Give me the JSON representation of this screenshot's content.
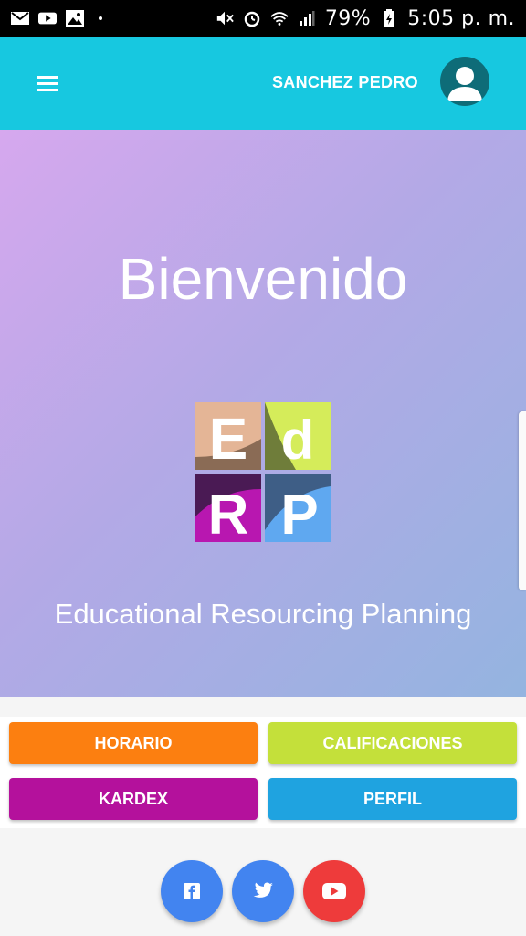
{
  "status_bar": {
    "battery": "79%",
    "time": "5:05 p. m.",
    "icons": [
      "gmail-icon",
      "youtube-icon",
      "gallery-icon",
      "mute-icon",
      "alarm-icon",
      "wifi-icon",
      "signal-icon",
      "battery-icon"
    ]
  },
  "header": {
    "user_name": "SANCHEZ PEDRO",
    "color": "#17c8e0"
  },
  "hero": {
    "title": "Bienvenido",
    "subtitle": "Educational Resourcing Planning",
    "logo_letters": [
      "E",
      "d",
      "R",
      "P"
    ]
  },
  "menu_buttons": [
    {
      "label": "HORARIO",
      "color": "#fc7f10"
    },
    {
      "label": "CALIFICACIONES",
      "color": "#c4e03a"
    },
    {
      "label": "KARDEX",
      "color": "#b4119c"
    },
    {
      "label": "PERFIL",
      "color": "#1fa3e0"
    }
  ],
  "social": [
    {
      "icon": "facebook-icon",
      "color": "#4284f0"
    },
    {
      "icon": "twitter-icon",
      "color": "#4284f0"
    },
    {
      "icon": "youtube-icon",
      "color": "#ee3b3b"
    }
  ]
}
